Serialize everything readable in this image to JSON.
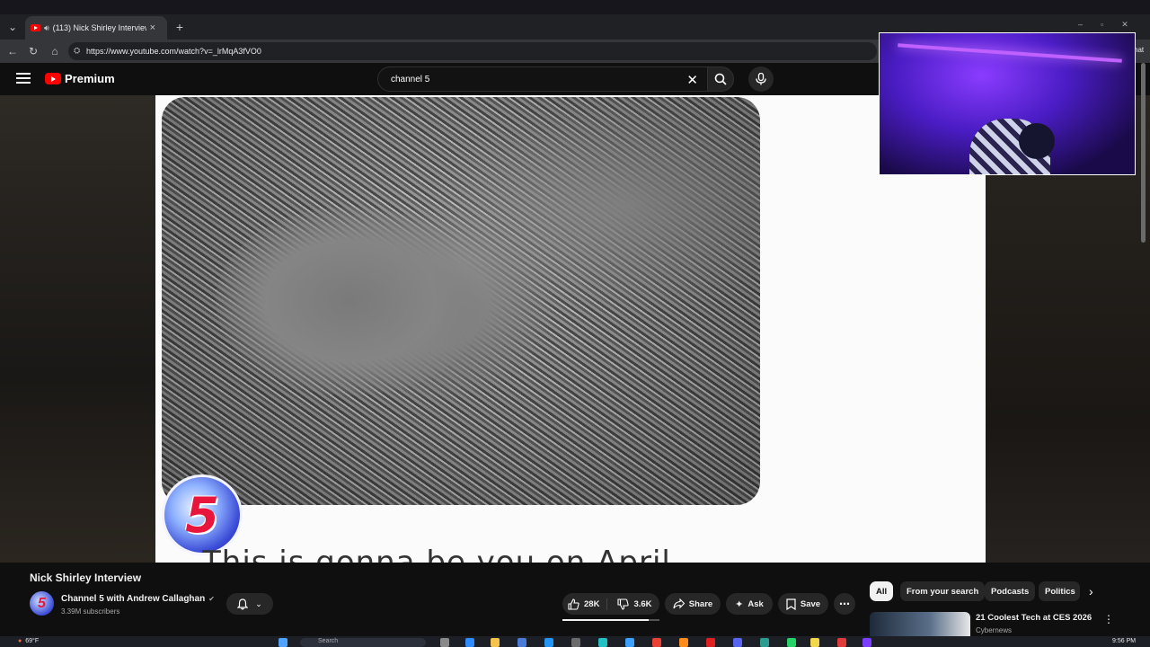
{
  "browser": {
    "tab_title": "(113) Nick Shirley Interview -",
    "url": "https://www.youtube.com/watch?v=_lrMqA3fVO0",
    "right_edge_text": "hat"
  },
  "youtube": {
    "logo_text": "Premium",
    "search_value": "channel 5"
  },
  "video": {
    "badge_text": "5",
    "caption_partial": "This is gonna be you on April"
  },
  "below": {
    "title": "Nick Shirley Interview",
    "channel_name": "Channel 5 with Andrew Callaghan",
    "avatar_text": "5",
    "subscribers": "3.39M subscribers",
    "likes": "28K",
    "like_ratio": 0.886,
    "dislikes": "3.6K",
    "share": "Share",
    "ask": "Ask",
    "save": "Save"
  },
  "filters": [
    "All",
    "From your search",
    "Podcasts",
    "Politics"
  ],
  "suggestion": {
    "title": "21 Coolest Tech at CES 2026",
    "channel": "Cybernews"
  },
  "taskbar": {
    "weather": "69°F",
    "search_placeholder": "Search",
    "time": "9:56 PM"
  },
  "colors": {
    "youtube_red": "#ff0000",
    "background": "#0f0f0f",
    "channel5_red": "#e8163c",
    "webcam_purple": "#6a2cff"
  }
}
